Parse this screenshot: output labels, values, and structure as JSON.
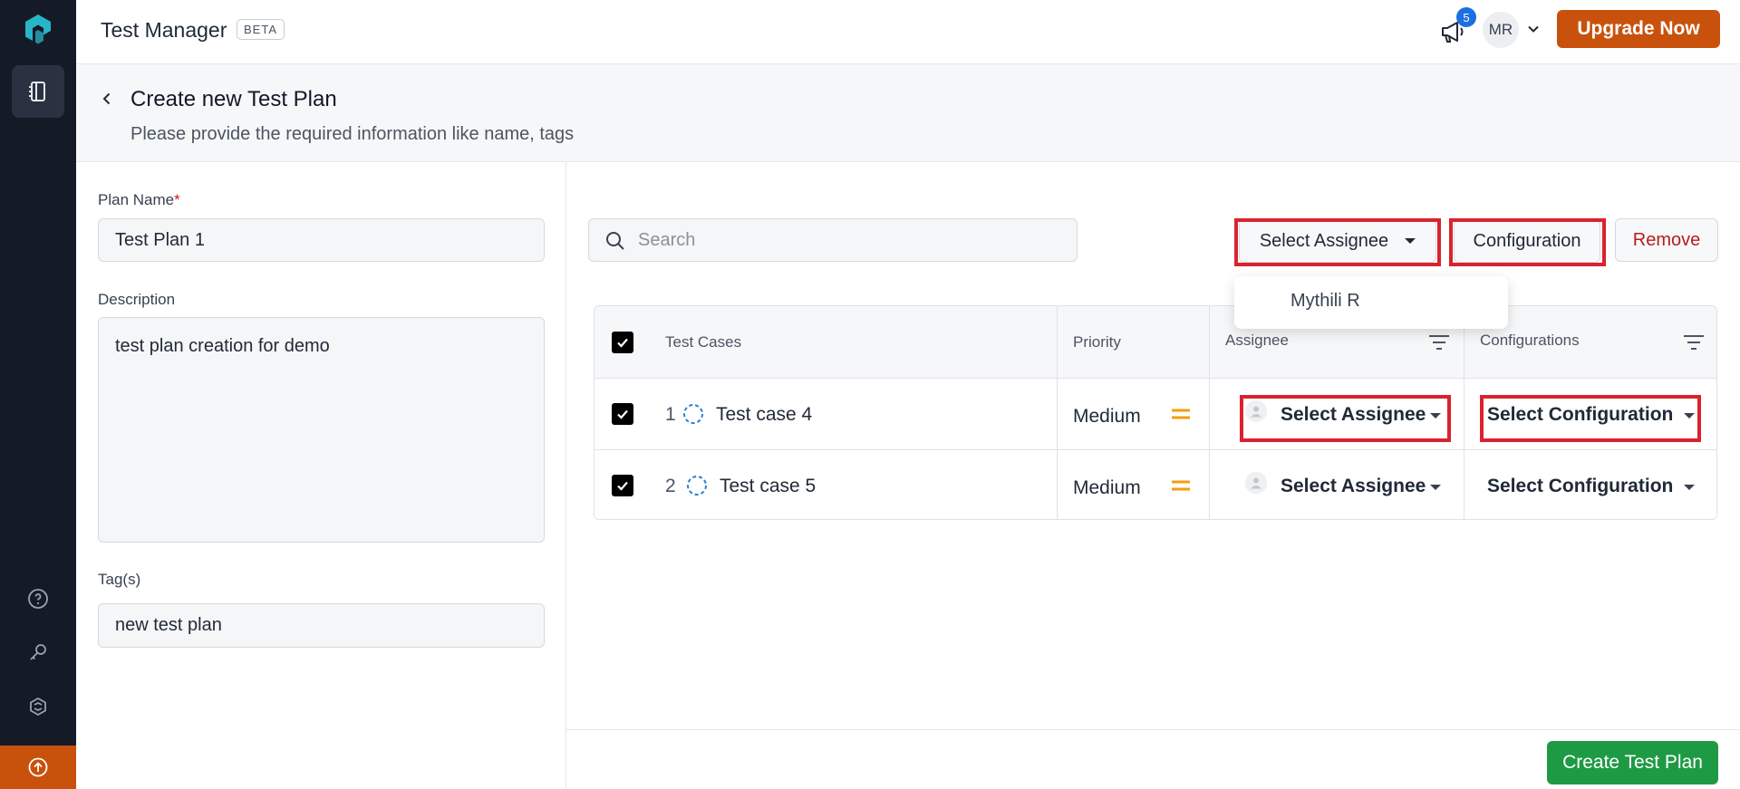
{
  "app": {
    "title": "Test Manager",
    "badge": "BETA"
  },
  "topbar": {
    "notifications_count": "5",
    "user_initials": "MR",
    "upgrade_label": "Upgrade Now"
  },
  "header": {
    "title": "Create new Test Plan",
    "subtitle": "Please provide the required information like name, tags"
  },
  "form": {
    "plan_name_label": "Plan Name",
    "required_mark": "*",
    "plan_name_value": "Test Plan 1",
    "description_label": "Description",
    "description_value": "test plan creation for demo",
    "tags_label": "Tag(s)",
    "tags_value": "new test plan"
  },
  "toolbar": {
    "search_placeholder": "Search",
    "select_assignee_label": "Select Assignee",
    "configuration_label": "Configuration",
    "remove_label": "Remove"
  },
  "assignee_dropdown": {
    "options": [
      "Mythili R"
    ]
  },
  "table": {
    "headers": {
      "test_cases": "Test Cases",
      "priority": "Priority",
      "assignee": "Assignee",
      "configurations": "Configurations"
    },
    "rows": [
      {
        "index": "1",
        "name": "Test case 4",
        "priority": "Medium",
        "assignee": "Select Assignee",
        "configuration": "Select Configuration"
      },
      {
        "index": "2",
        "name": "Test case 5",
        "priority": "Medium",
        "assignee": "Select Assignee",
        "configuration": "Select Configuration"
      }
    ]
  },
  "footer": {
    "create_label": "Create Test Plan"
  },
  "colors": {
    "accent_orange": "#c8520c",
    "create_green": "#1e9a45",
    "highlight_red": "#d9232f",
    "remove_red": "#b91c1c",
    "priority_medium": "#f59e0b"
  },
  "icons": [
    "app-logo-icon",
    "test-plans-nav-icon",
    "help-icon",
    "key-icon",
    "integrations-icon",
    "upgrade-arrow-icon",
    "megaphone-icon",
    "chevron-down-icon",
    "back-arrow-icon",
    "search-icon",
    "filter-icon",
    "checkbox-checked-icon",
    "draft-status-icon",
    "priority-medium-icon",
    "person-icon",
    "caret-down-icon"
  ]
}
